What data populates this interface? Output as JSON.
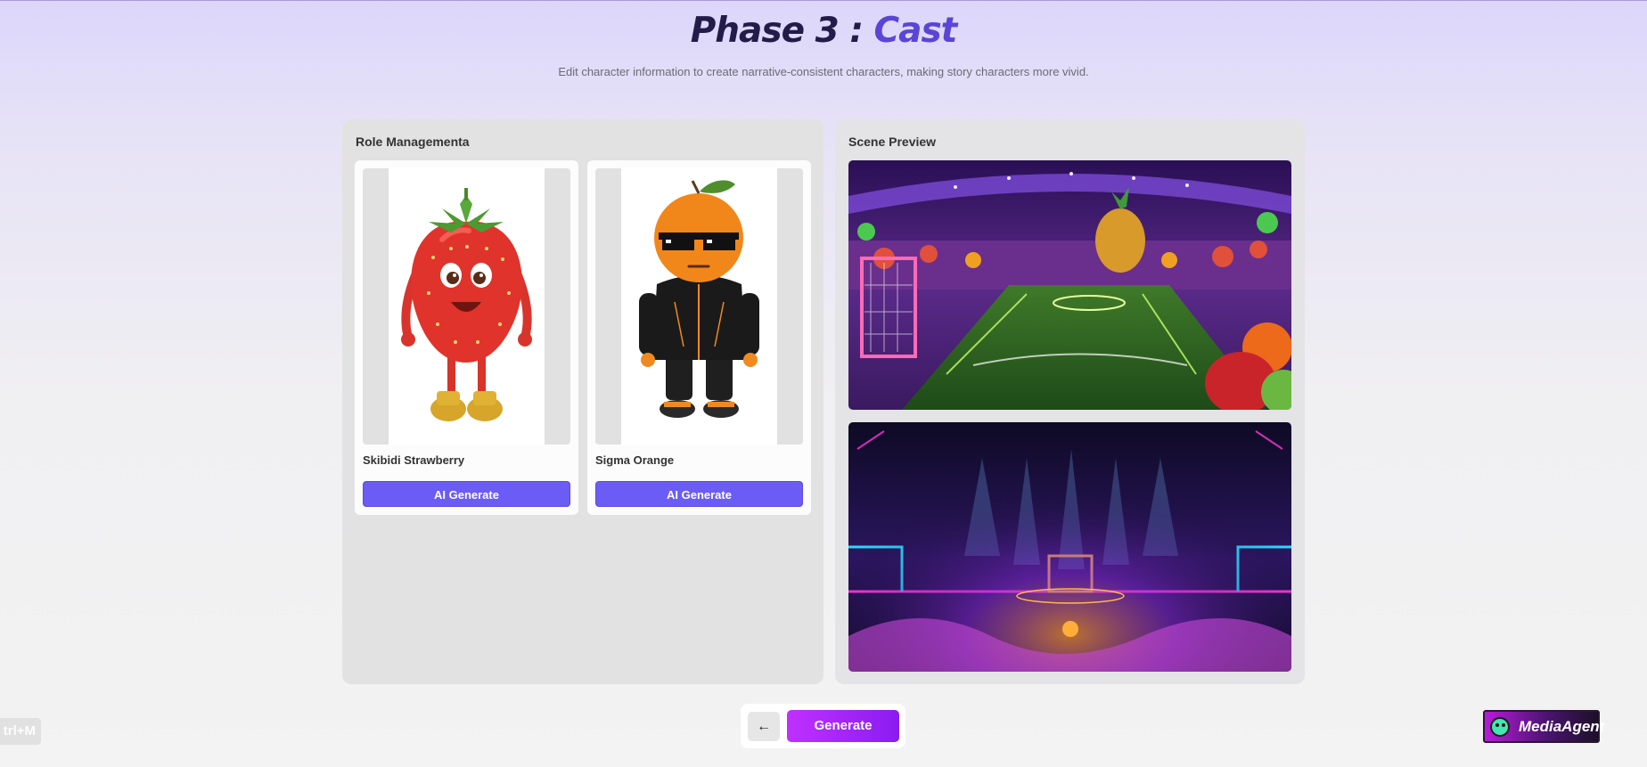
{
  "header": {
    "title_prefix": "Phase 3 : ",
    "title_accent": "Cast",
    "subtitle": "Edit character information to create narrative-consistent characters, making story characters more vivid."
  },
  "role_panel": {
    "title": "Role Managementa",
    "characters": [
      {
        "name": "Skibidi Strawberry",
        "image_icon": "strawberry-character-image",
        "button_label": "AI Generate"
      },
      {
        "name": "Sigma Orange",
        "image_icon": "orange-character-image",
        "button_label": "AI Generate"
      }
    ]
  },
  "scene_panel": {
    "title": "Scene Preview",
    "scenes": [
      {
        "image_icon": "fruit-stadium-scene-image"
      },
      {
        "image_icon": "neon-arena-scene-image"
      }
    ]
  },
  "footer": {
    "back_icon": "arrow-left-icon",
    "back_label": "←",
    "generate_label": "Generate",
    "shortcut_label": "trl+M",
    "brand_label": "MediaAgent"
  },
  "colors": {
    "accent": "#5a45d6",
    "button": "#6b5cf5",
    "generate_gradient_start": "#c030ff",
    "generate_gradient_end": "#8a1cf0"
  }
}
